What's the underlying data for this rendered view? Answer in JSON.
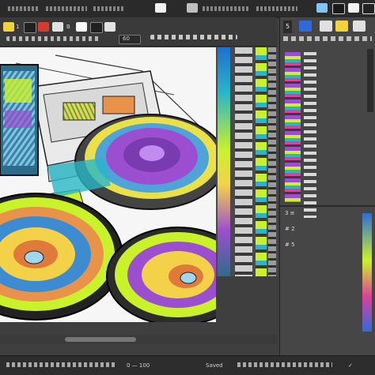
{
  "toolbar": {
    "zoom_label": "60",
    "tool_labels": [
      "1",
      "B"
    ]
  },
  "panel": {
    "tab_label": "5",
    "lower_labels": [
      "3 ≡",
      "# 2",
      "# 5"
    ]
  },
  "status": {
    "items": [
      "0 — 100",
      "Saved",
      "✓"
    ]
  },
  "colors": {
    "accent_lime": "#c9f22b",
    "accent_purple": "#9b4fd0",
    "accent_cyan": "#28b6c8",
    "panel_bg": "#464646"
  },
  "icons": [
    "grid-icon",
    "layers-icon",
    "settings-icon",
    "close-icon",
    "hand-icon",
    "zoom-icon"
  ]
}
